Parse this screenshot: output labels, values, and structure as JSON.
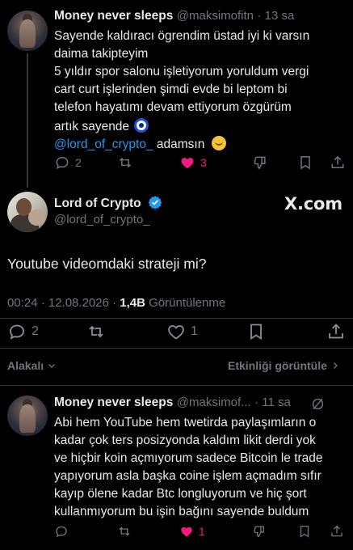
{
  "tweet1": {
    "name": "Money never sleeps",
    "handle": "@maksimofitn",
    "time": "· 13 sa",
    "lines": [
      "Sayende kaldıracı  ögrendim üstad iyi ki varsın",
      "daima takipteyim",
      "5 yıldır spor salonu işletiyorum yoruldum vergi",
      "cart curt işlerinden şimdi evde bi leptom bi",
      "telefon hayatımı devam ettiyorum özgürüm",
      "artık sayende"
    ],
    "mention": "@lord_of_crypto_",
    "mention_after": " adamsın",
    "replies": "2",
    "likes": "3"
  },
  "main": {
    "name": "Lord of Crypto",
    "handle": "@lord_of_crypto_",
    "watermark": "X.com",
    "text": "Youtube videomdaki strateji mi?",
    "meta_time": "00:24 · 12.08.2026 · ",
    "views_count": "1,4B",
    "views_label": " Görüntülenme",
    "replies": "2",
    "likes": "1"
  },
  "bar": {
    "relevant": "Alakalı",
    "activity": "Etkinliği görüntüle"
  },
  "tweet2": {
    "name": "Money never sleeps",
    "handle": "@maksimof...",
    "time": "· 11 sa",
    "lines": [
      "Abi hem YouTube hem twetirda paylaşımların o",
      "kadar çok ters posizyonda kaldım likit derdi yok",
      "ve hiçbir koin açmıyorum sadece Bitcoin le trade",
      "yapıyorum asla başka coine işlem açmadım sıfır",
      "kayıp ölene kadar Btc longluyorum ve hiç şort",
      "kullanmıyorum bu işin bağını sayende buldum"
    ],
    "likes": "1"
  }
}
